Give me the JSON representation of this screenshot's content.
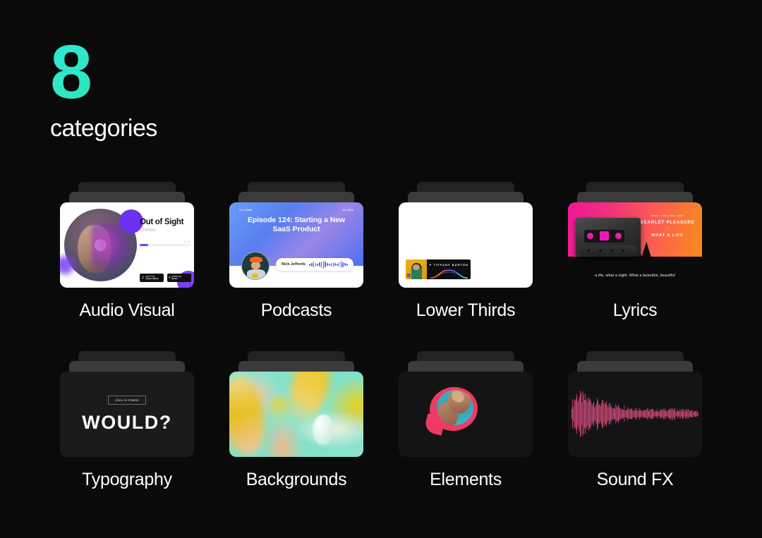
{
  "heading": {
    "number": "8",
    "label": "categories",
    "accent_gradient_from": "#2ee6d6",
    "accent_gradient_to": "#2ade9a"
  },
  "page": {
    "background": "#0a0a0a",
    "text_color": "#ffffff"
  },
  "categories": [
    {
      "id": "audio-visual",
      "label": "Audio Visual",
      "preview": {
        "kind": "music-player",
        "track_title": "Out of Sight",
        "artist": "Chelou",
        "time": "00:35",
        "progress_percent": 16,
        "accent": "#7c3ff7",
        "store_buttons": [
          {
            "small": "GET IT ON",
            "large": "Amazon Music"
          },
          {
            "small": "LISTEN ON",
            "large": "Deezer"
          }
        ]
      }
    },
    {
      "id": "podcasts",
      "label": "Podcasts",
      "preview": {
        "kind": "podcast-episode",
        "date": "13 JUNE",
        "duration": "33 MIN",
        "title": "Episode 124: Starting a New SaaS Product",
        "host": "Nick Jeffords",
        "accent": "#4a6df0"
      }
    },
    {
      "id": "lower-thirds",
      "label": "Lower Thirds",
      "preview": {
        "kind": "lower-third-banner",
        "name": "TIFFANY BARTON",
        "prefix": "✦"
      }
    },
    {
      "id": "lyrics",
      "label": "Lyrics",
      "preview": {
        "kind": "lyric-cassette",
        "album_meta": "Album • Oner Fabue • 2019",
        "artist": "SCARLET PLEASURE",
        "divider": "–",
        "song": "WHAT A LIFE",
        "lyric_line": "a life, what a night. What a beautiful, beautiful"
      }
    },
    {
      "id": "typography",
      "label": "Typography",
      "preview": {
        "kind": "type-poster",
        "tag": "Alice in Chains",
        "word": "WOULD?"
      }
    },
    {
      "id": "backgrounds",
      "label": "Backgrounds",
      "preview": {
        "kind": "abstract-gradient",
        "colors": [
          "#8fe6cd",
          "#ecc51f",
          "#f3c7ae"
        ]
      }
    },
    {
      "id": "elements",
      "label": "Elements",
      "preview": {
        "kind": "speech-bubble-cutout",
        "accent": "#ef3a63"
      }
    },
    {
      "id": "sound-fx",
      "label": "Sound FX",
      "preview": {
        "kind": "waveform",
        "gradient_from": "#f05a2a",
        "gradient_mid": "#e8407f",
        "gradient_to": "#9b4bd6"
      }
    }
  ]
}
